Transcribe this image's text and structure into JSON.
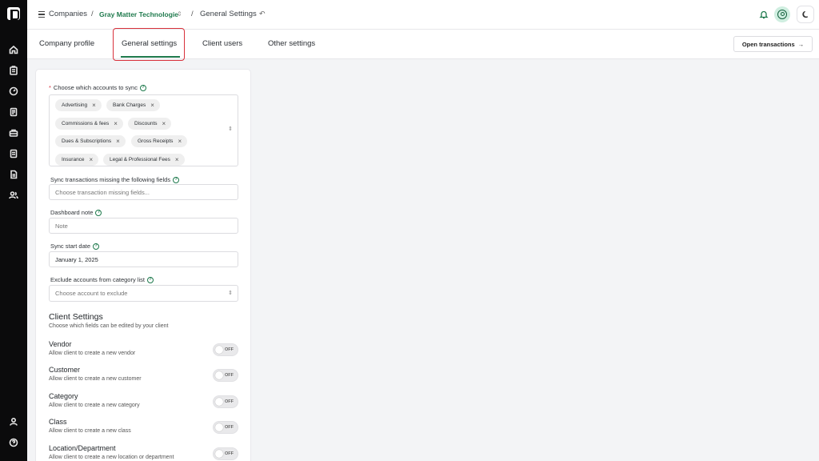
{
  "sidebar": {
    "icons": [
      "home-icon",
      "clipboard-icon",
      "gauge-icon",
      "receipt-icon",
      "briefcase-icon",
      "report-icon",
      "document-icon",
      "users-icon",
      "user-icon",
      "help-icon"
    ]
  },
  "header": {
    "companies_label": "Companies",
    "separator": "/",
    "company_name": "Gray Matter Technologie",
    "page_label": "General Settings"
  },
  "tabs": {
    "company_profile": "Company profile",
    "general_settings": "General settings",
    "client_users": "Client users",
    "other_settings": "Other settings",
    "open_transactions": "Open transactions"
  },
  "form": {
    "accounts_label": "Choose which accounts to sync",
    "required_mark": "*",
    "accounts": [
      "Advertising",
      "Bank Charges",
      "Commissions & fees",
      "Discounts",
      "Dues & Subscriptions",
      "Gross Receipts",
      "Insurance",
      "Legal & Professional Fees"
    ],
    "missing_fields_label": "Sync transactions missing the following fields",
    "missing_fields_placeholder": "Choose transaction missing fields...",
    "dashboard_note_label": "Dashboard note",
    "dashboard_note_placeholder": "Note",
    "start_date_label": "Sync start date",
    "start_date_value": "January 1, 2025",
    "exclude_label": "Exclude accounts from category list",
    "exclude_placeholder": "Choose account to exclude"
  },
  "client_settings": {
    "title": "Client Settings",
    "subtitle": "Choose which fields can be edited by your client",
    "toggle_off_text": "OFF",
    "items": [
      {
        "title": "Vendor",
        "desc": "Allow client to create a new vendor"
      },
      {
        "title": "Customer",
        "desc": "Allow client to create a new customer"
      },
      {
        "title": "Category",
        "desc": "Allow client to create a new category"
      },
      {
        "title": "Class",
        "desc": "Allow client to create a new class"
      },
      {
        "title": "Location/Department",
        "desc": "Allow client to create a new location or department"
      }
    ]
  }
}
